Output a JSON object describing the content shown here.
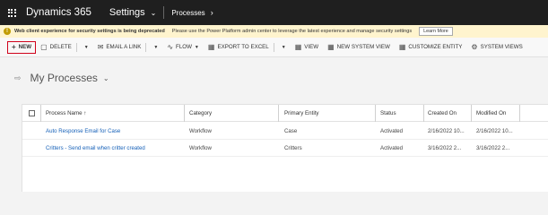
{
  "topbar": {
    "brand": "Dynamics 365",
    "area": "Settings",
    "breadcrumb": "Processes"
  },
  "warning": {
    "title": "Web client experience for security settings is being deprecated",
    "message": "Please use the Power Platform admin center to leverage the latest experience and manage security settings",
    "button": "Learn More"
  },
  "commands": {
    "new": "NEW",
    "delete": "DELETE",
    "email_link": "EMAIL A LINK",
    "flow": "FLOW",
    "export_excel": "EXPORT TO EXCEL",
    "view": "VIEW",
    "new_system_view": "NEW SYSTEM VIEW",
    "customize_entity": "CUSTOMIZE ENTITY",
    "system_views": "SYSTEM VIEWS"
  },
  "view": {
    "title": "My Processes"
  },
  "grid": {
    "columns": {
      "name": "Process Name ↑",
      "category": "Category",
      "entity": "Primary Entity",
      "status": "Status",
      "created": "Created On",
      "modified": "Modified On"
    },
    "rows": [
      {
        "name": "Auto Response Email for Case",
        "category": "Workflow",
        "entity": "Case",
        "status": "Activated",
        "created": "2/16/2022 10...",
        "modified": "2/16/2022 10..."
      },
      {
        "name": "Critters - Send email when critter created",
        "category": "Workflow",
        "entity": "Critters",
        "status": "Activated",
        "created": "3/16/2022 2...",
        "modified": "3/16/2022 2..."
      }
    ]
  },
  "colors": {
    "topbar": "#1f1f1f",
    "warning_bg": "#fff4ce",
    "link": "#1560b8",
    "highlight": "#d0021b"
  }
}
